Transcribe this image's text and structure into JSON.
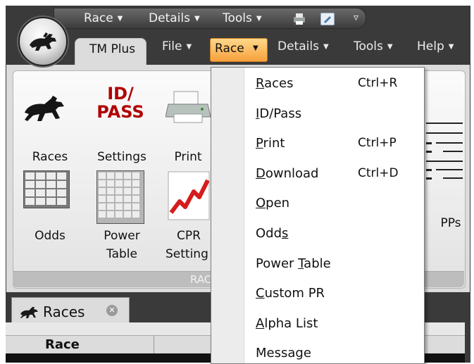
{
  "quick_access": {
    "items": [
      {
        "label": "Race"
      },
      {
        "label": "Details"
      },
      {
        "label": "Tools"
      }
    ],
    "overflow_glyph": "▿"
  },
  "tabs": {
    "active": "TM Plus",
    "items": [
      {
        "label": "File"
      },
      {
        "label": "Race"
      },
      {
        "label": "Details"
      },
      {
        "label": "Tools"
      },
      {
        "label": "Help"
      }
    ]
  },
  "ribbon": {
    "group_label": "RAC",
    "buttons": {
      "races": "Races",
      "settings": "Settings",
      "print": "Print",
      "odds": "Odds",
      "power_table_1": "Power",
      "power_table_2": "Table",
      "cpr_1": "CPR",
      "cpr_2": "Setting",
      "pps": "PPs"
    },
    "idpass_line1": "ID/",
    "idpass_line2": "PASS"
  },
  "race_menu": {
    "items": [
      {
        "label": "Races",
        "mnemonic": "R",
        "shortcut": "Ctrl+R"
      },
      {
        "label": "ID/Pass",
        "mnemonic": "I",
        "shortcut": ""
      },
      {
        "label": "Print",
        "mnemonic": "P",
        "shortcut": "Ctrl+P"
      },
      {
        "label": "Download",
        "mnemonic": "D",
        "shortcut": "Ctrl+D"
      },
      {
        "label": "Open",
        "mnemonic": "O",
        "shortcut": ""
      },
      {
        "label": "Odds",
        "mnemonic": "s",
        "shortcut": ""
      },
      {
        "label": "Power Table",
        "mnemonic": "T",
        "shortcut": ""
      },
      {
        "label": "Custom PR",
        "mnemonic": "C",
        "shortcut": ""
      },
      {
        "label": "Alpha List",
        "mnemonic": "A",
        "shortcut": ""
      },
      {
        "label": "Message",
        "mnemonic": "",
        "shortcut": ""
      }
    ]
  },
  "document_tab": {
    "label": "Races",
    "close_glyph": "✕"
  },
  "table": {
    "column_race": "Race"
  },
  "colors": {
    "accent_orange": "#f7a13c",
    "chrome_dark": "#3a3a3a",
    "idpass_red": "#b00000"
  }
}
